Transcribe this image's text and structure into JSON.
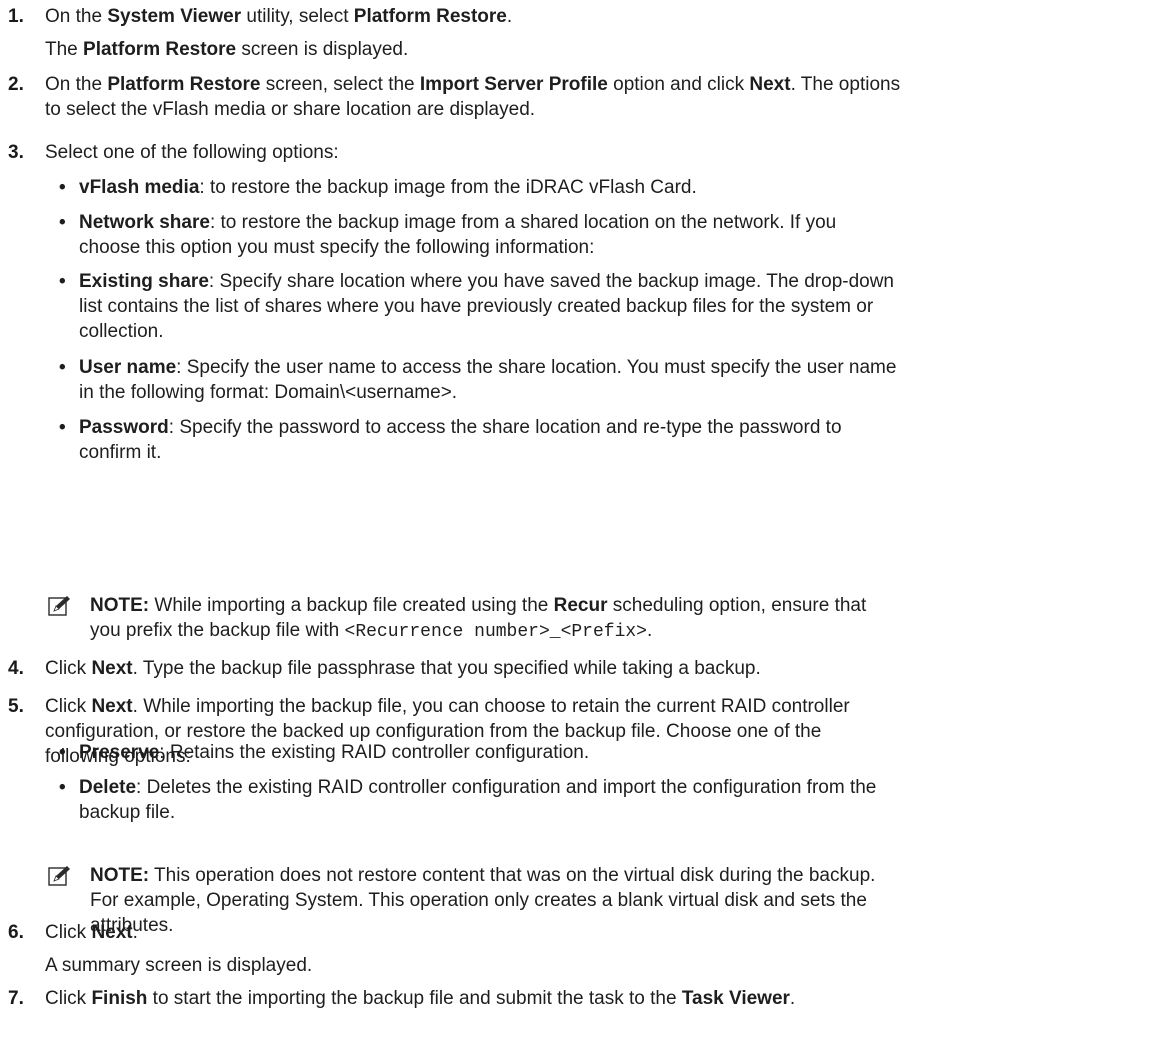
{
  "steps": [
    {
      "number": "1.",
      "lines": [
        [
          "On the ",
          {
            "b": "System Viewer"
          },
          " utility, select ",
          {
            "b": "Platform Restore"
          },
          "."
        ]
      ],
      "after": [
        [
          "The ",
          {
            "b": "Platform Restore"
          },
          " screen is displayed."
        ]
      ]
    },
    {
      "number": "2.",
      "lines": [
        [
          "On the ",
          {
            "b": "Platform Restore"
          },
          " screen, select the ",
          {
            "b": "Import Server Profile"
          },
          " option and click ",
          {
            "b": "Next"
          },
          ". The options"
        ],
        [
          "to select the vFlash media or share location are displayed."
        ]
      ]
    },
    {
      "number": "3.",
      "lines": [
        [
          "Select one of the following options:"
        ]
      ],
      "bullets": [
        [
          [
            {
              "b": "vFlash media"
            },
            ": to restore the backup image from the iDRAC vFlash Card."
          ]
        ],
        [
          [
            {
              "b": "Network share"
            },
            ": to restore the backup image from a shared location on the network. If you"
          ],
          [
            "choose this option you must specify the following information:"
          ]
        ],
        [
          [
            {
              "b": "Existing share"
            },
            ": Specify share location where you have saved the backup image. The drop-down"
          ],
          [
            "list contains the list of shares where you have previously created backup files for the system or"
          ],
          [
            "collection."
          ]
        ],
        [
          [
            {
              "b": "User name"
            },
            ": Specify the user name to access the share location. You must specify the user name"
          ],
          [
            "in the following format: Domain\\<username>."
          ]
        ],
        [
          [
            {
              "b": "Password"
            },
            ": Specify the password to access the share location and re-type the password to"
          ],
          [
            "confirm it."
          ]
        ]
      ],
      "note": [
        [
          {
            "b": "NOTE:"
          },
          " While importing a backup file created using the ",
          {
            "b": "Recur"
          },
          " scheduling option, ensure that"
        ],
        [
          "you prefix the backup file with ",
          {
            "m": "<Recurrence number>_<Prefix>"
          },
          "."
        ]
      ]
    },
    {
      "number": "4.",
      "lines": [
        [
          "Click ",
          {
            "b": "Next"
          },
          ". Type the backup file passphrase that you specified while taking a backup."
        ]
      ]
    },
    {
      "number": "5.",
      "lines": [
        [
          "Click ",
          {
            "b": "Next"
          },
          ". While importing the backup file, you can choose to retain the current RAID controller"
        ],
        [
          "configuration, or restore the backed up configuration from the backup file. Choose one of the"
        ],
        [
          "following options:"
        ]
      ],
      "bullets": [
        [
          [
            {
              "b": "Preserve"
            },
            ": Retains the existing RAID controller configuration."
          ]
        ],
        [
          [
            {
              "b": "Delete"
            },
            ": Deletes the existing RAID controller configuration and import the configuration from the"
          ],
          [
            "backup file."
          ]
        ]
      ],
      "note": [
        [
          {
            "b": "NOTE:"
          },
          " This operation does not restore content that was on the virtual disk during the backup."
        ],
        [
          "For example, Operating System. This operation only creates a blank virtual disk and sets the"
        ],
        [
          "attributes."
        ]
      ]
    },
    {
      "number": "6.",
      "lines": [
        [
          "Click ",
          {
            "b": "Next"
          },
          "."
        ]
      ],
      "after": [
        [
          "A summary screen is displayed."
        ]
      ]
    },
    {
      "number": "7.",
      "lines": [
        [
          "Click ",
          {
            "b": "Finish"
          },
          " to start the importing the backup file and submit the task to the ",
          {
            "b": "Task Viewer"
          },
          "."
        ]
      ]
    }
  ],
  "icons": {
    "note": "pencil-note-icon"
  },
  "colors": {
    "text": "#1e1e1e",
    "icon": "#2b2b2b"
  }
}
